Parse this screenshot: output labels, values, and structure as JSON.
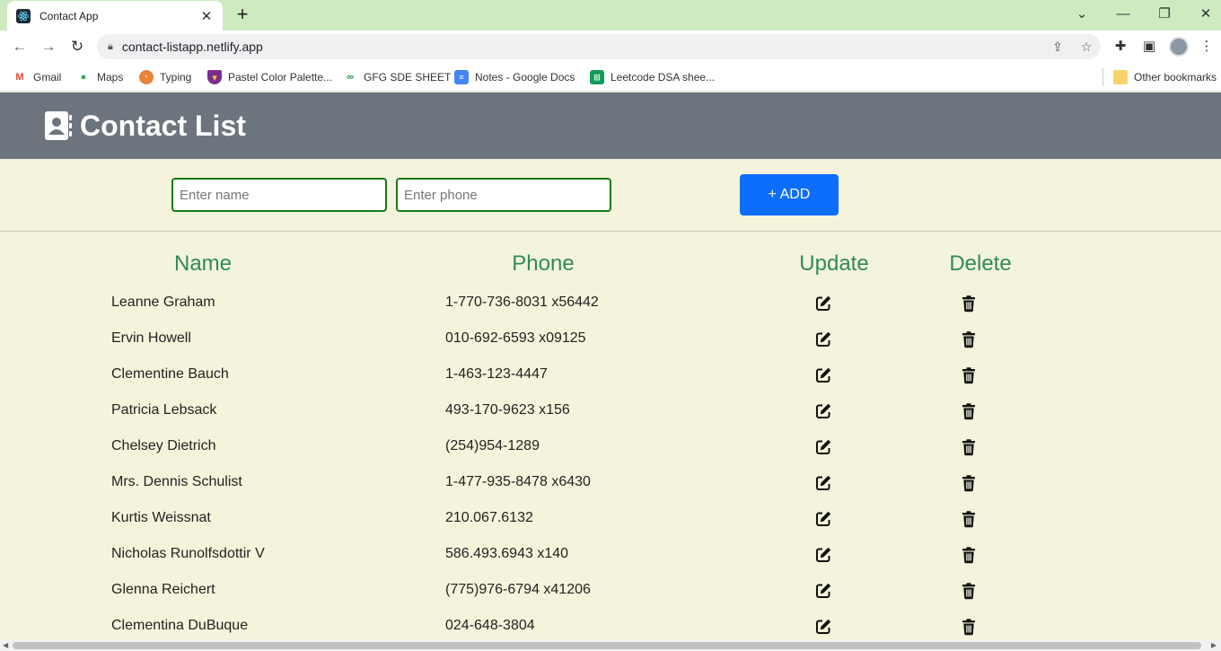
{
  "browser": {
    "tab_title": "Contact App",
    "url": "contact-listapp.netlify.app",
    "bookmarks": [
      {
        "label": "Gmail",
        "icon": "gmail-icon"
      },
      {
        "label": "Maps",
        "icon": "maps-icon"
      },
      {
        "label": "Typing",
        "icon": "typing-icon"
      },
      {
        "label": "Pastel Color Palette...",
        "icon": "pastel-icon"
      },
      {
        "label": "GFG SDE SHEET",
        "icon": "gfg-icon"
      },
      {
        "label": "Notes - Google Docs",
        "icon": "docs-icon"
      },
      {
        "label": "Leetcode DSA shee...",
        "icon": "sheets-icon"
      }
    ],
    "other_bookmarks": "Other bookmarks"
  },
  "app": {
    "title": "Contact List",
    "form": {
      "name_placeholder": "Enter name",
      "phone_placeholder": "Enter phone",
      "add_label": "+ ADD"
    },
    "headers": {
      "name": "Name",
      "phone": "Phone",
      "update": "Update",
      "delete": "Delete"
    },
    "contacts": [
      {
        "name": "Leanne Graham",
        "phone": "1-770-736-8031 x56442"
      },
      {
        "name": "Ervin Howell",
        "phone": "010-692-6593 x09125"
      },
      {
        "name": "Clementine Bauch",
        "phone": "1-463-123-4447"
      },
      {
        "name": "Patricia Lebsack",
        "phone": "493-170-9623 x156"
      },
      {
        "name": "Chelsey Dietrich",
        "phone": "(254)954-1289"
      },
      {
        "name": "Mrs. Dennis Schulist",
        "phone": "1-477-935-8478 x6430"
      },
      {
        "name": "Kurtis Weissnat",
        "phone": "210.067.6132"
      },
      {
        "name": "Nicholas Runolfsdottir V",
        "phone": "586.493.6943 x140"
      },
      {
        "name": "Glenna Reichert",
        "phone": "(775)976-6794 x41206"
      },
      {
        "name": "Clementina DuBuque",
        "phone": "024-648-3804"
      }
    ]
  },
  "colors": {
    "header_bg": "#6c757d",
    "page_bg": "#f4f4dc",
    "accent_green": "#2e8b57",
    "add_button": "#0d6efd"
  }
}
